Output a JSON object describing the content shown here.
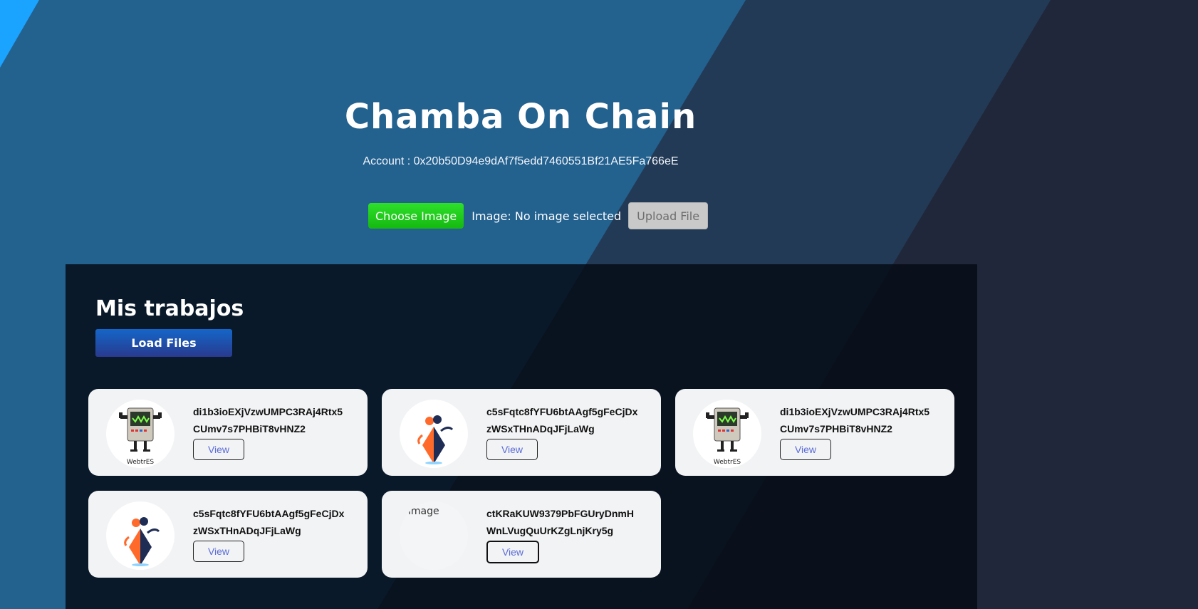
{
  "header": {
    "title": "Chamba On Chain",
    "account_label": "Account : 0x20b50D94e9dAf7f5edd7460551Bf21AE5Fa766eE"
  },
  "upload": {
    "choose_label": "Choose Image",
    "status_text": "Image: No image selected",
    "upload_label": "Upload File"
  },
  "jobs": {
    "heading": "Mis trabajos",
    "load_label": "Load Files",
    "view_label": "View",
    "items": [
      {
        "hash": "di1b3ioEXjVzwUMPC3RAj4Rtx5CUmv7s7PHBiT8vHNZ2",
        "thumbnail": "robot-icon",
        "thumb_caption": "WebtrES"
      },
      {
        "hash": "c5sFqtc8fYFU6btAAgf5gFeCjDxzWSxTHnADqJFjLaWg",
        "thumbnail": "ethereum-icon"
      },
      {
        "hash": "di1b3ioEXjVzwUMPC3RAj4Rtx5CUmv7s7PHBiT8vHNZ2",
        "thumbnail": "robot-icon",
        "thumb_caption": "WebtrES"
      },
      {
        "hash": "c5sFqtc8fYFU6btAAgf5gFeCjDxzWSxTHnADqJFjLaWg",
        "thumbnail": "ethereum-icon"
      },
      {
        "hash": "ctKRaKUW9379PbFGUryDnmHWnLVugQuUrKZgLnjKry5g",
        "thumbnail": "broken-image-icon",
        "alt_text": "image"
      }
    ]
  },
  "colors": {
    "choose_green": "#22cc1c",
    "load_blue": "#1466c8",
    "view_text": "#5b6cd6",
    "hero_blue": "#246096"
  }
}
